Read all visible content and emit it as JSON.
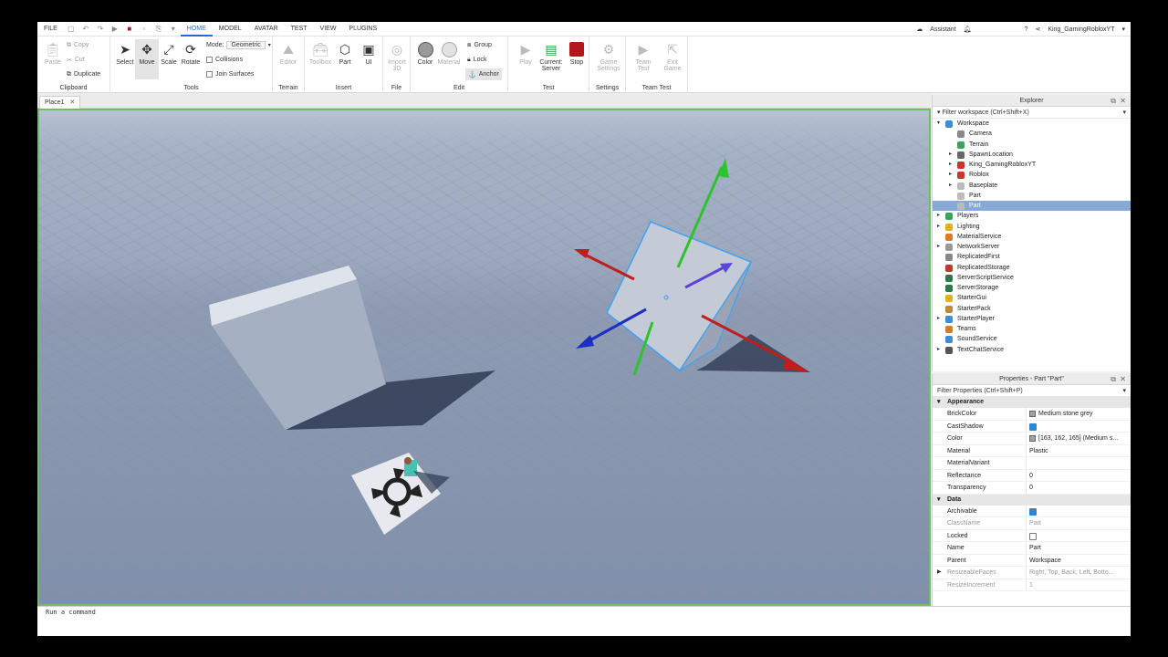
{
  "menu": {
    "tabs": [
      "FILE",
      "HOME",
      "MODEL",
      "AVATAR",
      "TEST",
      "VIEW",
      "PLUGINS"
    ],
    "active": "HOME",
    "assistant": "Assistant",
    "user": "King_GamingRobloxYT"
  },
  "ribbon": {
    "clipboard": {
      "label": "Clipboard",
      "paste": "Paste",
      "copy": "Copy",
      "cut": "Cut",
      "duplicate": "Duplicate"
    },
    "tools": {
      "label": "Tools",
      "select": "Select",
      "move": "Move",
      "scale": "Scale",
      "rotate": "Rotate",
      "mode_label": "Mode:",
      "mode_value": "Geometric",
      "collisions": "Collisions",
      "join_surfaces": "Join Surfaces"
    },
    "terrain": {
      "label": "Terrain",
      "editor": "Editor"
    },
    "insert": {
      "label": "Insert",
      "toolbox": "Toolbox",
      "part": "Part",
      "ui": "UI"
    },
    "file": {
      "label": "File",
      "import3d_l1": "Import",
      "import3d_l2": "3D"
    },
    "edit": {
      "label": "Edit",
      "color": "Color",
      "material": "Material",
      "group": "Group",
      "lock": "Lock",
      "anchor": "Anchor"
    },
    "test": {
      "label": "Test",
      "play": "Play",
      "current_l1": "Current:",
      "current_l2": "Server",
      "stop": "Stop"
    },
    "settings": {
      "label": "Settings",
      "game_l1": "Game",
      "game_l2": "Settings"
    },
    "teamtest": {
      "label": "Team Test",
      "team_l1": "Team",
      "team_l2": "Test",
      "exit_l1": "Exit",
      "exit_l2": "Game"
    }
  },
  "doc_tab": "Place1",
  "command_placeholder": "Run a command",
  "explorer": {
    "title": "Explorer",
    "filter": "Filter workspace (Ctrl+Shift+X)",
    "items": [
      {
        "label": "Workspace",
        "depth": 0,
        "arrow": "open",
        "color": "#3b8ed6"
      },
      {
        "label": "Camera",
        "depth": 1,
        "arrow": "",
        "color": "#888888"
      },
      {
        "label": "Terrain",
        "depth": 1,
        "arrow": "",
        "color": "#3aa35a"
      },
      {
        "label": "SpawnLocation",
        "depth": 1,
        "arrow": "closed",
        "color": "#666666"
      },
      {
        "label": "King_GamingRobloxYT",
        "depth": 1,
        "arrow": "closed",
        "color": "#c0392b"
      },
      {
        "label": "Roblox",
        "depth": 1,
        "arrow": "closed",
        "color": "#c0392b"
      },
      {
        "label": "Baseplate",
        "depth": 1,
        "arrow": "closed",
        "color": "#bbbbbb"
      },
      {
        "label": "Part",
        "depth": 1,
        "arrow": "",
        "color": "#bbbbbb"
      },
      {
        "label": "Part",
        "depth": 1,
        "arrow": "",
        "color": "#bbbbbb",
        "selected": true
      },
      {
        "label": "Players",
        "depth": 0,
        "arrow": "closed",
        "color": "#3aa35a"
      },
      {
        "label": "Lighting",
        "depth": 0,
        "arrow": "closed",
        "color": "#e0b020"
      },
      {
        "label": "MaterialService",
        "depth": 0,
        "arrow": "",
        "color": "#d97a2b"
      },
      {
        "label": "NetworkServer",
        "depth": 0,
        "arrow": "closed",
        "color": "#999999"
      },
      {
        "label": "ReplicatedFirst",
        "depth": 0,
        "arrow": "",
        "color": "#888888"
      },
      {
        "label": "ReplicatedStorage",
        "depth": 0,
        "arrow": "",
        "color": "#c0392b"
      },
      {
        "label": "ServerScriptService",
        "depth": 0,
        "arrow": "",
        "color": "#2b7a4b"
      },
      {
        "label": "ServerStorage",
        "depth": 0,
        "arrow": "",
        "color": "#2b7a4b"
      },
      {
        "label": "StarterGui",
        "depth": 0,
        "arrow": "",
        "color": "#e0b020"
      },
      {
        "label": "StarterPack",
        "depth": 0,
        "arrow": "",
        "color": "#c08a3a"
      },
      {
        "label": "StarterPlayer",
        "depth": 0,
        "arrow": "closed",
        "color": "#3b8ed6"
      },
      {
        "label": "Teams",
        "depth": 0,
        "arrow": "",
        "color": "#d97a2b"
      },
      {
        "label": "SoundService",
        "depth": 0,
        "arrow": "",
        "color": "#3b8ed6"
      },
      {
        "label": "TextChatService",
        "depth": 0,
        "arrow": "closed",
        "color": "#555555"
      }
    ]
  },
  "properties": {
    "title": "Properties - Part \"Part\"",
    "filter": "Filter Properties (Ctrl+Shift+P)",
    "appearance": "Appearance",
    "data": "Data",
    "brickcolor": {
      "name": "BrickColor",
      "value": "Medium stone grey"
    },
    "castshadow": {
      "name": "CastShadow",
      "checked": true
    },
    "color": {
      "name": "Color",
      "value": "[163, 162, 165] (Medium s..."
    },
    "material": {
      "name": "Material",
      "value": "Plastic"
    },
    "materialvariant": {
      "name": "MaterialVariant",
      "value": ""
    },
    "reflectance": {
      "name": "Reflectance",
      "value": "0"
    },
    "transparency": {
      "name": "Transparency",
      "value": "0"
    },
    "archivable": {
      "name": "Archivable",
      "checked": true
    },
    "classname": {
      "name": "ClassName",
      "value": "Part"
    },
    "locked": {
      "name": "Locked",
      "checked": false
    },
    "name": {
      "name": "Name",
      "value": "Part"
    },
    "parent": {
      "name": "Parent",
      "value": "Workspace"
    },
    "resizeablefaces": {
      "name": "ResizeableFaces",
      "value": "Right, Top, Back, Left, Botto..."
    },
    "resizeincrement": {
      "name": "ResizeIncrement",
      "value": "1"
    }
  }
}
